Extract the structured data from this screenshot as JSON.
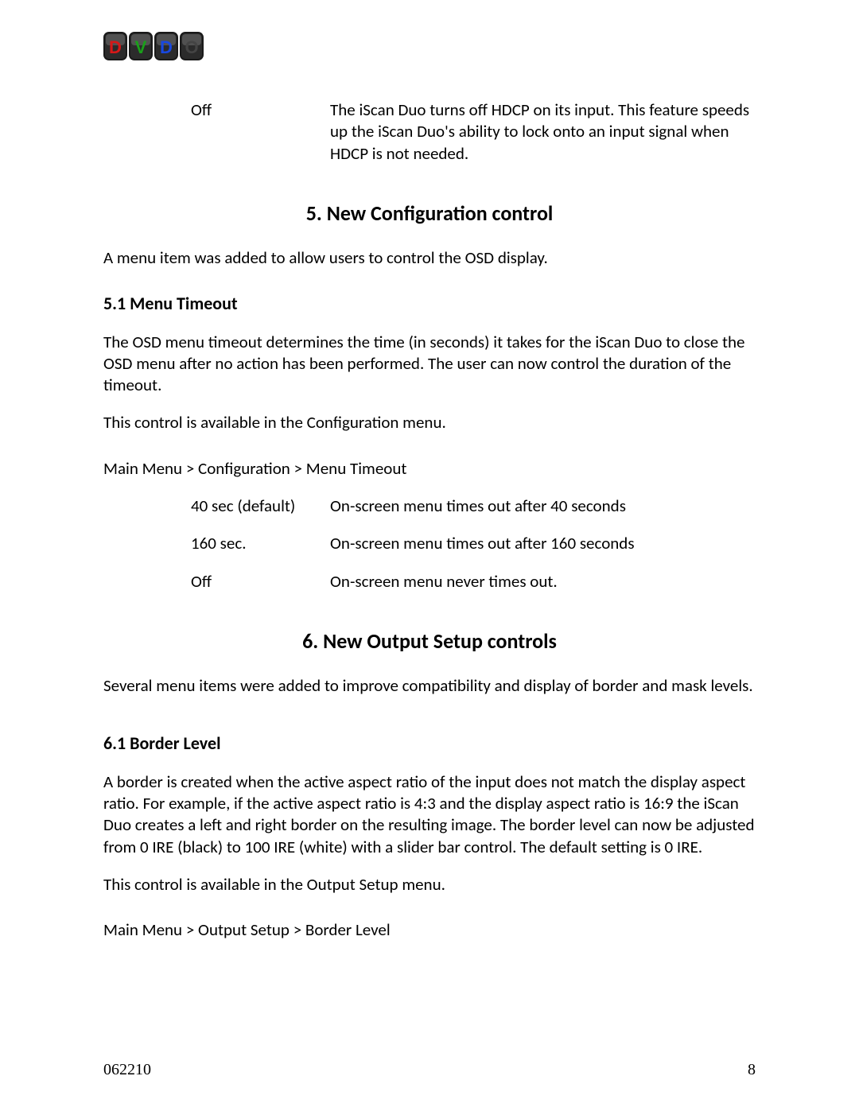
{
  "logo": {
    "letters": [
      "D",
      "V",
      "D",
      "O"
    ],
    "colors": [
      "#d61818",
      "#1aa01a",
      "#1848e0",
      "#444444"
    ]
  },
  "top_def": {
    "term": "Off",
    "desc": "The iScan Duo turns off HDCP on its input.  This feature speeds up the iScan Duo's ability to lock onto an input signal when HDCP is not needed."
  },
  "section5": {
    "heading": "5.  New Configuration control",
    "intro": "A menu item was added to allow users to control the OSD display.",
    "sub_heading": "5.1 Menu Timeout",
    "para1": "The OSD menu timeout determines the time (in seconds) it takes for the iScan Duo to close the OSD menu after no action has been performed.  The user can now control the duration of the timeout.",
    "para2": "This control is available in the Configuration menu.",
    "path": "Main Menu > Configuration > Menu Timeout",
    "options": [
      {
        "term": "40 sec (default)",
        "desc": "On-screen menu times out after 40 seconds"
      },
      {
        "term": "160 sec.",
        "desc": "On-screen menu times out after 160 seconds"
      },
      {
        "term": "Off",
        "desc": "On-screen menu never times out."
      }
    ]
  },
  "section6": {
    "heading": "6.  New Output Setup controls",
    "intro": "Several menu items were added to improve compatibility and display of border and mask levels.",
    "sub_heading": "6.1 Border Level",
    "para1": "A border is created when the active aspect ratio of the input does not match the display aspect ratio.  For example, if the active aspect ratio is 4:3 and the display aspect ratio is 16:9 the iScan Duo creates a left and right border on the resulting image.  The border level can now be adjusted from 0 IRE (black) to 100 IRE (white) with a slider bar control.  The default setting is 0 IRE.",
    "para2": "This control is available in the Output Setup menu.",
    "path": "Main Menu > Output Setup > Border Level"
  },
  "footer": {
    "left": "062210",
    "right": "8"
  }
}
